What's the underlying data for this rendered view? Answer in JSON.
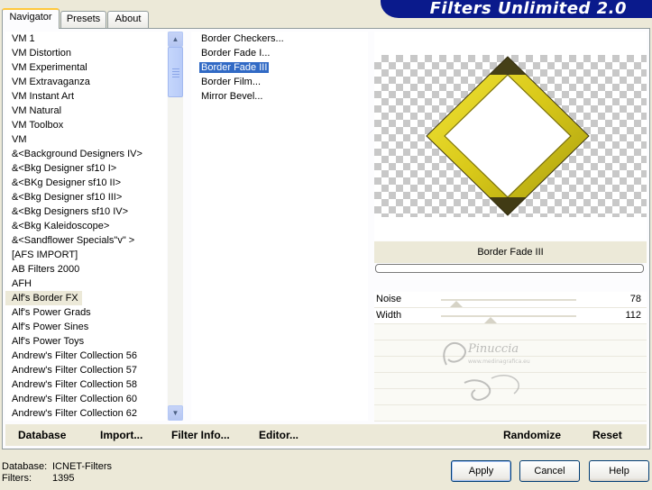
{
  "tabs": [
    "Navigator",
    "Presets",
    "About"
  ],
  "banner": "Filters Unlimited 2.0",
  "categories": [
    "VM 1",
    "VM Distortion",
    "VM Experimental",
    "VM Extravaganza",
    "VM Instant Art",
    "VM Natural",
    "VM Toolbox",
    "VM",
    "&<Background Designers IV>",
    "&<Bkg Designer sf10 I>",
    "&<BKg Designer sf10 II>",
    "&<Bkg Designer sf10 III>",
    "&<Bkg Designers sf10 IV>",
    "&<Bkg Kaleidoscope>",
    "&<Sandflower Specials\"v\" >",
    "[AFS IMPORT]",
    "AB Filters 2000",
    "AFH",
    "Alf's Border FX",
    "Alf's Power Grads",
    "Alf's Power Sines",
    "Alf's Power Toys",
    "Andrew's Filter Collection 56",
    "Andrew's Filter Collection 57",
    "Andrew's Filter Collection 58",
    "Andrew's Filter Collection 60",
    "Andrew's Filter Collection 62"
  ],
  "selected_category": "Alf's Border FX",
  "filters": [
    "Border Checkers...",
    "Border Fade I...",
    "Border Fade III",
    "Border Film...",
    "Mirror Bevel..."
  ],
  "selected_filter": "Border Fade III",
  "preview": {
    "filter_name": "Border Fade III"
  },
  "params": [
    {
      "label": "Noise",
      "value": "78"
    },
    {
      "label": "Width",
      "value": "112"
    }
  ],
  "watermark": {
    "name": "Pinuccia",
    "url": "www.medinagrafica.eu"
  },
  "toolbar": {
    "database": "Database",
    "import": "Import...",
    "filter_info": "Filter Info...",
    "editor": "Editor...",
    "randomize": "Randomize",
    "reset": "Reset"
  },
  "status": {
    "database_label": "Database:",
    "database_value": "ICNET-Filters",
    "filters_label": "Filters:",
    "filters_value": "1395"
  },
  "buttons": {
    "apply": "Apply",
    "cancel": "Cancel",
    "help": "Help"
  },
  "colors": {
    "banner": "#0a1a8c",
    "selection": "#316ac5",
    "diamond": "#e0d020"
  }
}
